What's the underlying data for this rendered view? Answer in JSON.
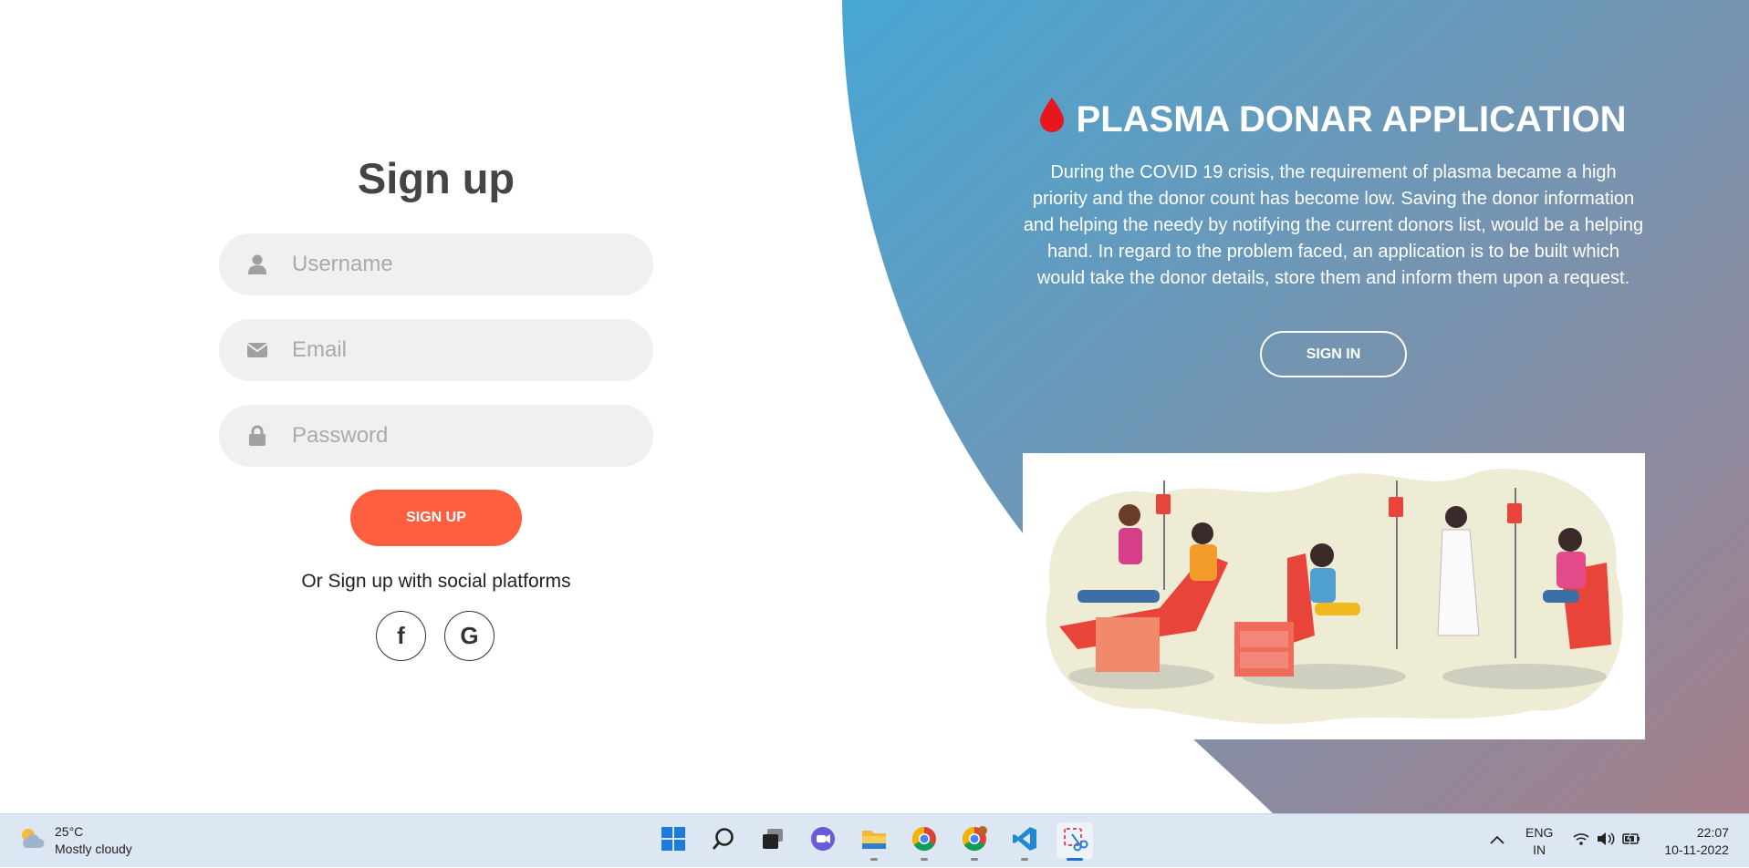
{
  "signup": {
    "title": "Sign up",
    "username_placeholder": "Username",
    "email_placeholder": "Email",
    "password_placeholder": "Password",
    "submit_label": "SIGN UP",
    "social_text": "Or Sign up with social platforms",
    "social": [
      {
        "name": "facebook-icon",
        "glyph": "f"
      },
      {
        "name": "google-icon",
        "glyph": "G"
      }
    ]
  },
  "panel": {
    "title": "PLASMA DONAR APPLICATION",
    "description": "During the COVID 19 crisis, the requirement of plasma became a high priority and the donor count has become low. Saving the donor information and helping the needy by notifying the current donors list, would be a helping hand. In regard to the problem faced, an application is to be built which would take the donor details, store them and inform them upon a request.",
    "signin_label": "SIGN IN",
    "gradient_start": "#4aa4d0",
    "gradient_end": "#a88090",
    "drop_color": "#e8161e"
  },
  "colors": {
    "accent": "#ff5f3e",
    "field_bg": "#f0f0f0"
  },
  "taskbar": {
    "weather_temp": "25°C",
    "weather_desc": "Mostly cloudy",
    "apps": [
      "start-icon",
      "search-icon",
      "task-view-icon",
      "chat-icon",
      "file-explorer-icon",
      "chrome-icon",
      "chrome-profile-icon",
      "vscode-icon",
      "snipping-tool-icon"
    ],
    "lang_1": "ENG",
    "lang_2": "IN",
    "time": "22:07",
    "date": "10-11-2022"
  }
}
